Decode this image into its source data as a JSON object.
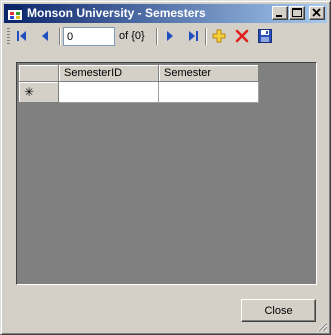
{
  "window": {
    "title": "Monson University - Semesters",
    "icons": {
      "app": "app-form-icon",
      "minimize": "minimize-icon",
      "maximize": "maximize-icon",
      "close": "close-icon"
    }
  },
  "navigator": {
    "position_value": "0",
    "count_label": "of {0}",
    "icons": [
      "move-first-icon",
      "move-previous-icon",
      "move-next-icon",
      "move-last-icon",
      "add-new-icon",
      "delete-icon",
      "save-icon"
    ]
  },
  "grid": {
    "columns": [
      "SemesterID",
      "Semester"
    ],
    "new_row_marker": "✳",
    "rows": []
  },
  "buttons": {
    "close_label": "Close"
  },
  "colors": {
    "title_start": "#0a246a",
    "title_end": "#a6caf0",
    "grid_bg": "#808080",
    "chrome": "#d4d0c8"
  }
}
